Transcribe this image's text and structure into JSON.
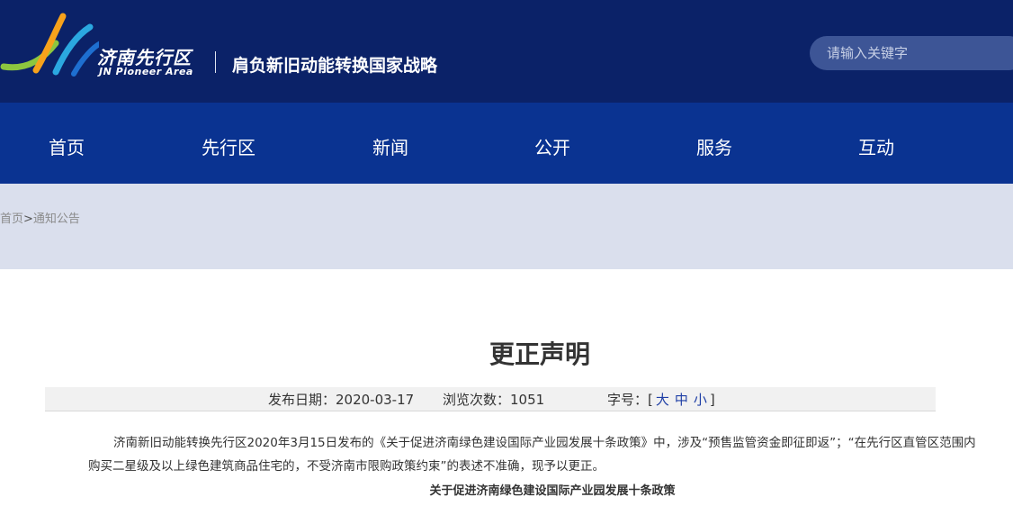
{
  "header": {
    "logo_cn": "济南先行区",
    "logo_en": "JN Pioneer Area",
    "slogan": "肩负新旧动能转换国家战略",
    "search_placeholder": "请输入关键字"
  },
  "nav": {
    "items": [
      "首页",
      "先行区",
      "新闻",
      "公开",
      "服务",
      "互动"
    ]
  },
  "breadcrumb": {
    "home": "首页",
    "separator": ">",
    "current": "通知公告"
  },
  "article": {
    "title": "更正声明",
    "date": "发布日期：2020-03-17",
    "views": "浏览次数：1051",
    "font_size_label": "字号：[",
    "font_size_options": [
      "大",
      "中",
      "小"
    ],
    "font_size_close": "]",
    "body": "济南新旧动能转换先行区2020年3月15日发布的《关于促进济南绿色建设国际产业园发展十条政策》中，涉及“预售监管资金即征即返”；“在先行区直管区范围内购买二星级及以上绿色建筑商品住宅的，不受济南市限购政策约束”的表述不准确，现予以更正。",
    "subtitle": "关于促进济南绿色建设国际产业园发展十条政策"
  },
  "colors": {
    "header_bg": "#0b2268",
    "nav_bg": "#0a3391",
    "breadcrumb_bg": "#dadfed",
    "link": "#1f3fa6"
  }
}
